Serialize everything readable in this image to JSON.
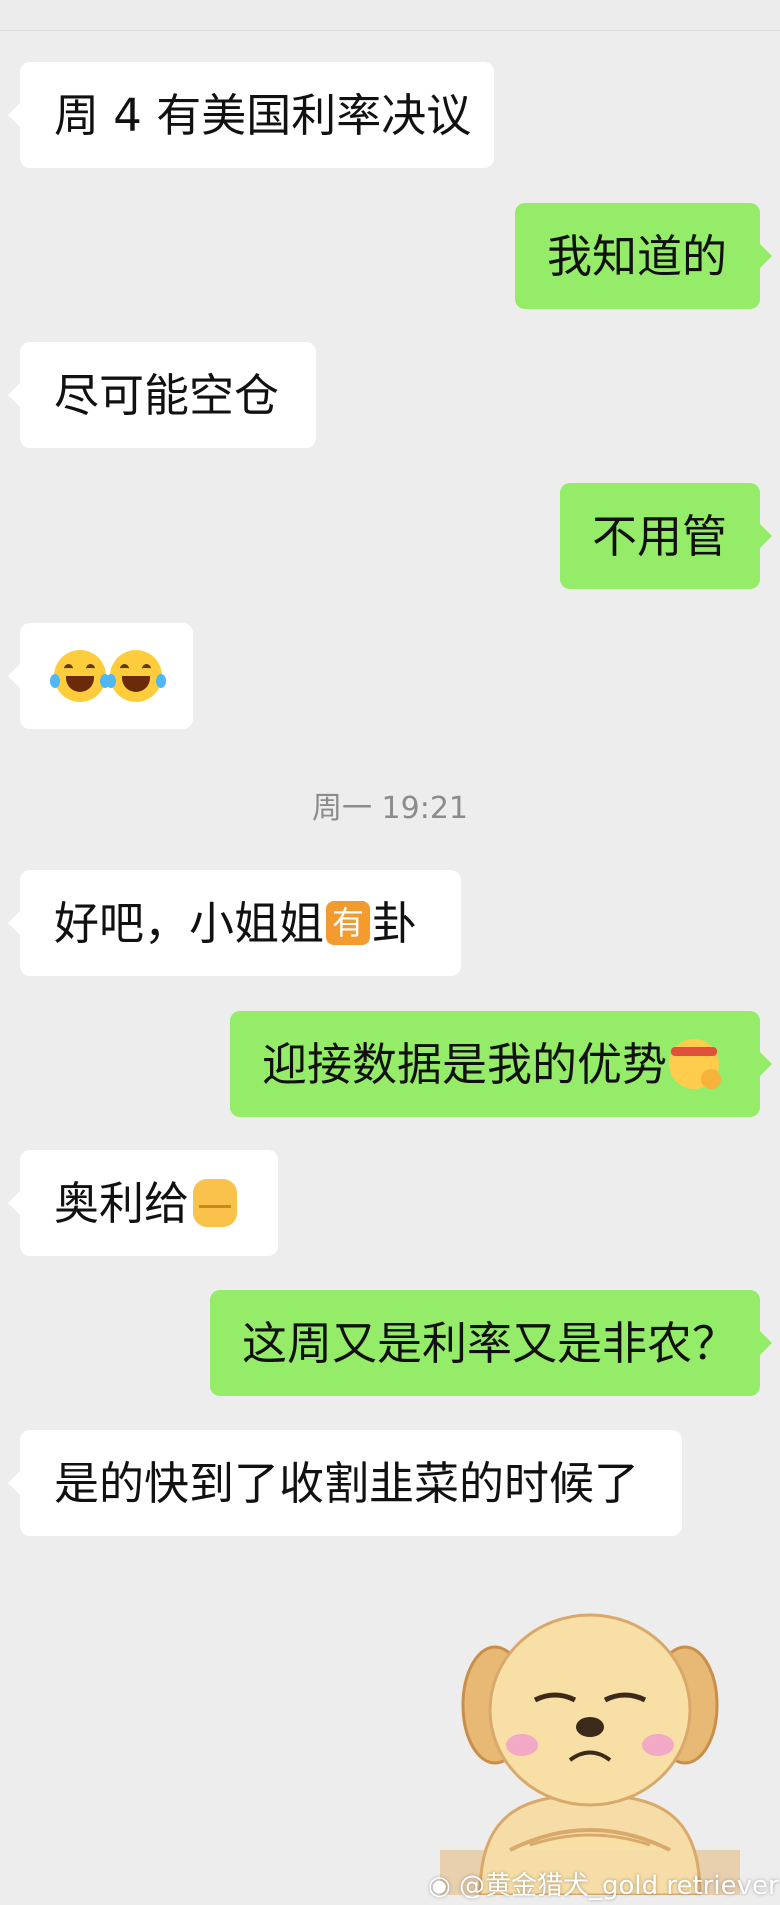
{
  "chat": {
    "messages": [
      {
        "side": "left",
        "text": "周 4 有美国利率决议"
      },
      {
        "side": "right",
        "text": "我知道的"
      },
      {
        "side": "left",
        "text": "尽可能空仓"
      },
      {
        "side": "right",
        "text": "不用管"
      },
      {
        "side": "left",
        "emoji": "laughing-crying-emoji",
        "count": 2
      },
      {
        "side": "left",
        "text_before": "好吧，小姐姐",
        "badge": "有",
        "text_after": "卦"
      },
      {
        "side": "right",
        "text": "迎接数据是我的优势",
        "emoji": "hushed-face-headband-emoji"
      },
      {
        "side": "left",
        "text": "奥利给",
        "emoji": "raised-fist-emoji"
      },
      {
        "side": "right",
        "text": "这周又是利率又是非农？"
      },
      {
        "side": "left",
        "text": "是的快到了收割韭菜的时候了"
      }
    ],
    "timestamp": "周一 19:21",
    "sticker": "sad-dog-sticker"
  },
  "watermark": {
    "text": "@黄金猎犬_gold retriever",
    "icon": "weibo-icon"
  },
  "colors": {
    "background": "#ededed",
    "bubble_left": "#ffffff",
    "bubble_right": "#95ec69"
  }
}
